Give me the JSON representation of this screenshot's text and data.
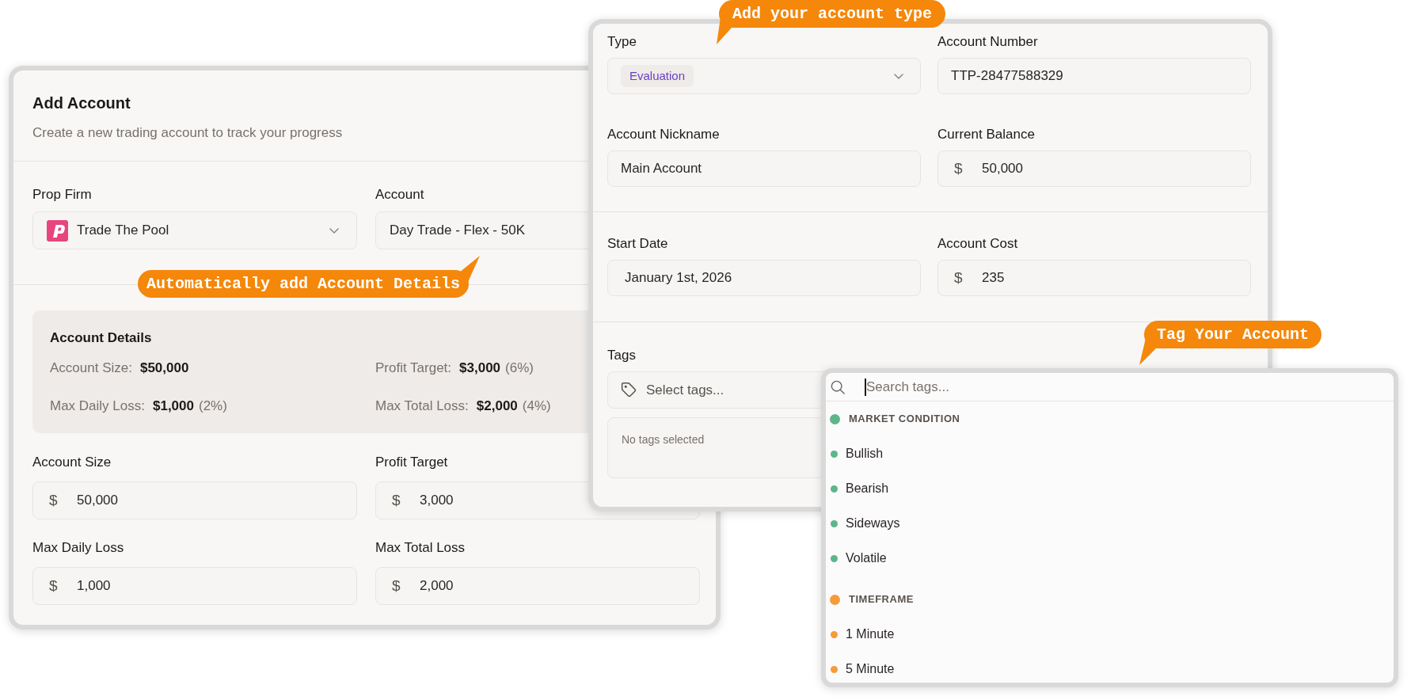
{
  "add_account": {
    "title": "Add Account",
    "subtitle": "Create a new trading account to track your progress",
    "selects": [
      {
        "kind": "firm",
        "label": "Prop Firm",
        "value": "Trade The Pool"
      },
      {
        "kind": "plain",
        "label": "Account",
        "value": "Day Trade - Flex - 50K"
      }
    ],
    "callout": "Automatically add Account Details",
    "details": {
      "title": "Account Details",
      "items": [
        {
          "label": "Account Size:",
          "value": "$50,000"
        },
        {
          "label": "Profit Target:",
          "value": "$3,000",
          "note": "(6%)"
        },
        {
          "label": "Max Daily Loss:",
          "value": "$1,000",
          "note": "(2%)"
        },
        {
          "label": "Max Total Loss:",
          "value": "$2,000",
          "note": "(4%)"
        }
      ]
    },
    "fields": [
      {
        "label": "Account Size",
        "prefix": "$",
        "value": "50,000"
      },
      {
        "label": "Profit Target",
        "prefix": "$",
        "value": "3,000"
      },
      {
        "label": "Max Daily Loss",
        "prefix": "$",
        "value": "1,000"
      },
      {
        "label": "Max Total Loss",
        "prefix": "$",
        "value": "2,000"
      }
    ]
  },
  "account_form": {
    "callout": "Add your account type",
    "sections": [
      {
        "fields": [
          {
            "kind": "select",
            "label": "Type",
            "badge": "Evaluation"
          },
          {
            "kind": "text",
            "label": "Account Number",
            "value": "TTP-28477588329"
          },
          {
            "kind": "text",
            "label": "Account Nickname",
            "value": "Main Account"
          },
          {
            "kind": "amount",
            "label": "Current Balance",
            "prefix": "$",
            "value": "50,000"
          }
        ]
      },
      {
        "fields": [
          {
            "kind": "date",
            "label": "Start Date",
            "value": "January 1st, 2026"
          },
          {
            "kind": "amount",
            "label": "Account Cost",
            "prefix": "$",
            "value": "235"
          }
        ]
      }
    ],
    "tags": {
      "label": "Tags",
      "placeholder": "Select tags...",
      "empty_message": "No tags selected"
    }
  },
  "tag_dropdown": {
    "callout": "Tag Your Account",
    "search": {
      "placeholder": "Search tags...",
      "focused": true
    },
    "groups": [
      {
        "name": "MARKET CONDITION",
        "color": "#5cb68a",
        "tags": [
          {
            "label": "Bullish",
            "selected": false
          },
          {
            "label": "Bearish",
            "selected": false
          },
          {
            "label": "Sideways",
            "selected": false
          },
          {
            "label": "Volatile",
            "selected": false
          }
        ]
      },
      {
        "name": "TIMEFRAME",
        "color": "#f59b3a",
        "tags": [
          {
            "label": "1 Minute",
            "selected": false
          },
          {
            "label": "5 Minute",
            "selected": false
          }
        ]
      }
    ]
  }
}
